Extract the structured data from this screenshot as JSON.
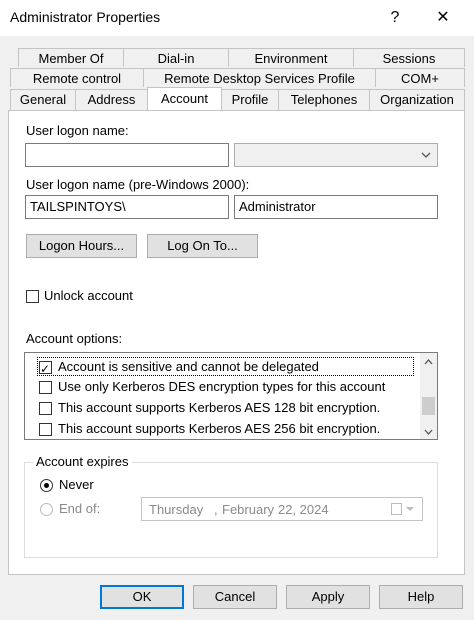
{
  "window": {
    "title": "Administrator Properties",
    "help_glyph": "?",
    "close_glyph": "✕"
  },
  "tabs": {
    "row1": [
      "Member Of",
      "Dial-in",
      "Environment",
      "Sessions"
    ],
    "row2": [
      "Remote control",
      "Remote Desktop Services Profile",
      "COM+"
    ],
    "row3": [
      "General",
      "Address",
      "Account",
      "Profile",
      "Telephones",
      "Organization"
    ],
    "active": "Account"
  },
  "account": {
    "user_logon_label": "User logon name:",
    "user_logon_value": "",
    "pre2000_label": "User logon name (pre-Windows 2000):",
    "domain_value": "TAILSPINTOYS\\",
    "pre2000_value": "Administrator",
    "logon_hours_button": "Logon Hours...",
    "log_on_to_button": "Log On To...",
    "unlock_label": "Unlock account",
    "options_label": "Account options:",
    "options": [
      {
        "label": "Account is sensitive and cannot be delegated",
        "checked": true
      },
      {
        "label": "Use only Kerberos DES encryption types for this account",
        "checked": false
      },
      {
        "label": "This account supports Kerberos AES 128 bit encryption.",
        "checked": false
      },
      {
        "label": "This account supports Kerberos AES 256 bit encryption.",
        "checked": false
      }
    ],
    "expires_label": "Account expires",
    "never_label": "Never",
    "end_of_label": "End of:",
    "end_of_date": {
      "weekday": "Thursday",
      "sep": ",",
      "month": "February",
      "day_year": "22, 2024"
    }
  },
  "footer": {
    "ok": "OK",
    "cancel": "Cancel",
    "apply": "Apply",
    "help": "Help"
  },
  "colors": {
    "accent": "#0078d7",
    "disabled": "#8a8a8a"
  }
}
